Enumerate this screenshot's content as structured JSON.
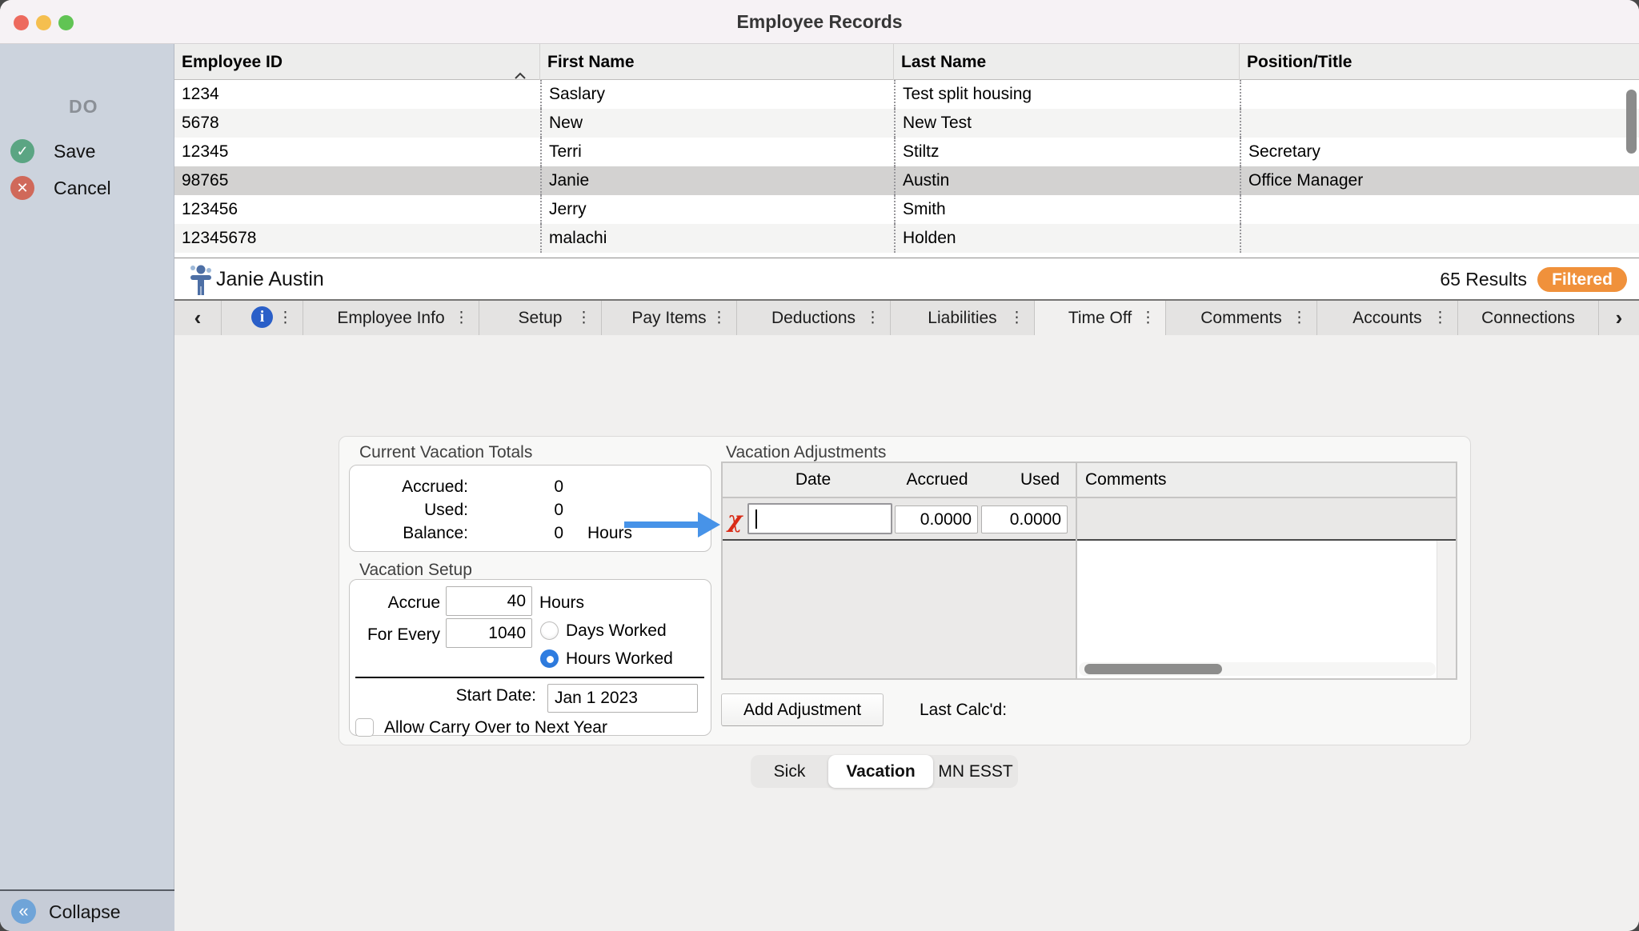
{
  "window": {
    "title": "Employee Records"
  },
  "sidebar": {
    "header": "DO",
    "save_label": "Save",
    "cancel_label": "Cancel",
    "collapse_label": "Collapse"
  },
  "table": {
    "columns": [
      {
        "label": "Employee ID",
        "sorted": "asc"
      },
      {
        "label": "First Name"
      },
      {
        "label": "Last Name"
      },
      {
        "label": "Position/Title"
      }
    ],
    "rows": [
      [
        "1234",
        "Saslary",
        "Test split housing",
        ""
      ],
      [
        "5678",
        "New",
        "New Test",
        ""
      ],
      [
        "12345",
        "Terri",
        "Stiltz",
        "Secretary"
      ],
      [
        "98765",
        "Janie",
        "Austin",
        "Office Manager"
      ],
      [
        "123456",
        "Jerry",
        "Smith",
        ""
      ],
      [
        "12345678",
        "malachi",
        "Holden",
        ""
      ]
    ],
    "selected_row_index": 3
  },
  "status_bar": {
    "employee_name": "Janie Austin",
    "results_text": "65 Results",
    "filter_badge": "Filtered",
    "badge_color": "#f0913b"
  },
  "tab_bar": {
    "tabs": [
      {
        "label": "Employee Info",
        "has_menu": true,
        "selected": false
      },
      {
        "label": "Setup",
        "has_menu": true,
        "selected": false
      },
      {
        "label": "Pay Items",
        "has_menu": true,
        "selected": false
      },
      {
        "label": "Deductions",
        "has_menu": true,
        "selected": false
      },
      {
        "label": "Liabilities",
        "has_menu": true,
        "selected": false
      },
      {
        "label": "Time Off",
        "has_menu": true,
        "selected": true
      },
      {
        "label": "Comments",
        "has_menu": true,
        "selected": false
      },
      {
        "label": "Accounts",
        "has_menu": true,
        "selected": false
      },
      {
        "label": "Connections",
        "has_menu": false,
        "selected": false
      }
    ]
  },
  "time_off": {
    "totals": {
      "title": "Current Vacation Totals",
      "rows": [
        {
          "label": "Accrued:",
          "value": "0",
          "unit": ""
        },
        {
          "label": "Used:",
          "value": "0",
          "unit": ""
        },
        {
          "label": "Balance:",
          "value": "0",
          "unit": "Hours"
        }
      ]
    },
    "setup": {
      "title": "Vacation Setup",
      "accrue_label": "Accrue",
      "accrue_value": "40",
      "accrue_unit": "Hours",
      "for_every_label": "For Every",
      "for_every_value": "1040",
      "radio_options": [
        {
          "label": "Days Worked",
          "selected": false
        },
        {
          "label": "Hours Worked",
          "selected": true
        }
      ],
      "start_date_label": "Start Date:",
      "start_date_value": "Jan 1 2023",
      "carry_over_label": "Allow Carry Over to Next Year",
      "carry_over_checked": false
    },
    "adjustments": {
      "title": "Vacation Adjustments",
      "columns": [
        "Date",
        "Accrued",
        "Used",
        "Comments"
      ],
      "row": {
        "date": "",
        "accrued": "0.0000",
        "used": "0.0000",
        "comments": ""
      },
      "add_button_label": "Add Adjustment",
      "last_calcd_label": "Last Calc'd:"
    },
    "category_tabs": [
      {
        "label": "Sick",
        "selected": false
      },
      {
        "label": "Vacation",
        "selected": true
      },
      {
        "label": "MN ESST",
        "selected": false
      }
    ]
  },
  "icons": {
    "back_chevron": "‹",
    "forward_chevron": "›",
    "menu_dots": "⋮",
    "collapse_chevrons": "«",
    "info_glyph": "i",
    "save_check": "✓",
    "cancel_cross": "✕",
    "delete_row_glyph": "χ"
  },
  "colors": {
    "badge_orange": "#f0913b",
    "save_green": "#5ba583",
    "cancel_red": "#d0695a",
    "collapse_blue": "#6fa4d8",
    "info_blue": "#2a5fc8",
    "radio_blue": "#2f7de1",
    "arrow_blue": "#4793e8",
    "delete_red": "#d92b17"
  }
}
